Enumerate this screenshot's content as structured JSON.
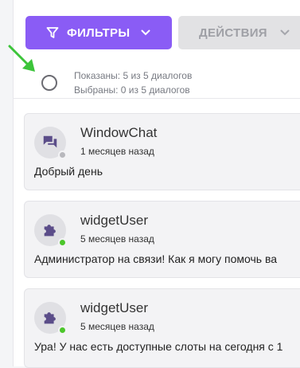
{
  "toolbar": {
    "filter_label": "ФИЛЬТРЫ",
    "actions_label": "ДЕЙСТВИЯ"
  },
  "selection": {
    "shown_text": "Показаны: 5 из 5 диалогов",
    "selected_text": "Выбраны: 0 из 5 диалогов"
  },
  "dialogs": [
    {
      "name": "WindowChat",
      "time": "1 месяцев назад",
      "message": "Добрый день",
      "avatar_icon": "chat-icon",
      "status": "offline",
      "status_color": "#b8b8bd"
    },
    {
      "name": "widgetUser",
      "time": "5 месяцев назад",
      "message": "Администратор на связи! Как я могу помочь ва",
      "avatar_icon": "puzzle-icon",
      "status": "online",
      "status_color": "#4cc62b"
    },
    {
      "name": "widgetUser",
      "time": "5 месяцев назад",
      "message": "Ура! У нас есть доступные слоты на сегодня с 1",
      "avatar_icon": "puzzle-icon",
      "status": "online",
      "status_color": "#4cc62b"
    }
  ],
  "colors": {
    "accent": "#8a5cf5",
    "disabled": "#e2e2e4",
    "arrow": "#3cc43a"
  }
}
